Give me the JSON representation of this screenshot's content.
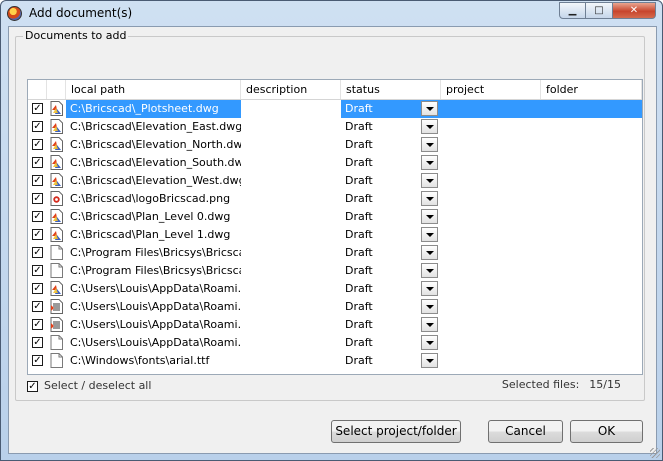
{
  "window": {
    "title": "Add document(s)"
  },
  "group": {
    "label": "Documents to add"
  },
  "columns": [
    "",
    "local path",
    "description",
    "status",
    "project",
    "folder"
  ],
  "rows": [
    {
      "path": "C:\\Bricscad\\_Plotsheet.dwg",
      "status": "Draft",
      "icon": "dwg-file-icon",
      "selected": true
    },
    {
      "path": "C:\\Bricscad\\Elevation_East.dwg",
      "status": "Draft",
      "icon": "dwg-file-icon"
    },
    {
      "path": "C:\\Bricscad\\Elevation_North.dwg",
      "status": "Draft",
      "icon": "dwg-file-icon"
    },
    {
      "path": "C:\\Bricscad\\Elevation_South.dwg",
      "status": "Draft",
      "icon": "dwg-file-icon"
    },
    {
      "path": "C:\\Bricscad\\Elevation_West.dwg",
      "status": "Draft",
      "icon": "dwg-file-icon"
    },
    {
      "path": "C:\\Bricscad\\logoBricscad.png",
      "status": "Draft",
      "icon": "png-file-icon"
    },
    {
      "path": "C:\\Bricscad\\Plan_Level 0.dwg",
      "status": "Draft",
      "icon": "dwg-file-icon"
    },
    {
      "path": "C:\\Bricscad\\Plan_Level 1.dwg",
      "status": "Draft",
      "icon": "dwg-file-icon"
    },
    {
      "path": "C:\\Program Files\\Bricsys\\Bricsca...",
      "status": "Draft",
      "icon": "blank-file-icon"
    },
    {
      "path": "C:\\Program Files\\Bricsys\\Bricsca...",
      "status": "Draft",
      "icon": "blank-file-icon"
    },
    {
      "path": "C:\\Users\\Louis\\AppData\\Roami...",
      "status": "Draft",
      "icon": "dwg-file-icon"
    },
    {
      "path": "C:\\Users\\Louis\\AppData\\Roami...",
      "status": "Draft",
      "icon": "text-file-icon"
    },
    {
      "path": "C:\\Users\\Louis\\AppData\\Roami...",
      "status": "Draft",
      "icon": "text-file-icon"
    },
    {
      "path": "C:\\Users\\Louis\\AppData\\Roami...",
      "status": "Draft",
      "icon": "blank-file-icon"
    },
    {
      "path": "C:\\Windows\\fonts\\arial.ttf",
      "status": "Draft",
      "icon": "blank-file-icon"
    }
  ],
  "select_all": {
    "label": "Select / deselect all",
    "checked": true
  },
  "selected_files": {
    "label": "Selected files:",
    "count": "15/15"
  },
  "buttons": {
    "select_project": "Select project/folder",
    "cancel": "Cancel",
    "ok": "OK"
  },
  "colors": {
    "selection": "#3399ff",
    "client_bg": "#f0f0f0",
    "title_bg": "#c4d8ee"
  }
}
